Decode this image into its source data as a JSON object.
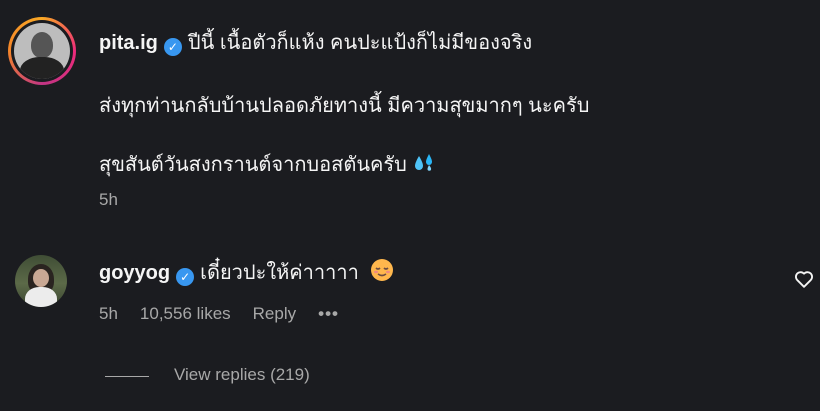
{
  "comment": {
    "username": "pita.ig",
    "verified_icon": "verified-badge-icon",
    "line1": "ปีนี้ เนื้อตัวก็แห้ง คนปะแป้งก็ไม่มีของจริง",
    "line2": "ส่งทุกท่านกลับบ้านปลอดภัยทางนี้ มีความสุขมากๆ นะครับ",
    "line3": "สุขสันต์วันสงกรานต์จากบอสตันครับ",
    "line3_emoji": "sweat-droplets-icon",
    "time": "5h"
  },
  "reply": {
    "username": "goyyog",
    "verified_icon": "verified-badge-icon",
    "text": "เดี๋ยวปะให้ค่าาาาา",
    "emoji": "relieved-face-icon",
    "time": "5h",
    "likes": "10,556 likes",
    "reply_label": "Reply",
    "more_label": "•••",
    "like_icon": "heart-icon"
  },
  "view_replies": "View replies (219)",
  "colors": {
    "background": "#1b1c20",
    "text": "#f5f5f5",
    "muted": "#a8a8a8",
    "verified": "#3897f0"
  }
}
